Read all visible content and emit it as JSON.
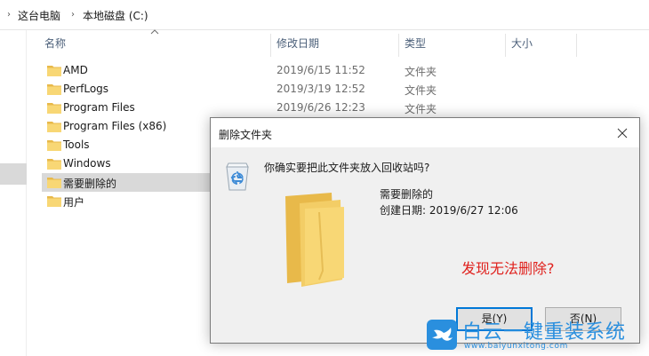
{
  "breadcrumb": {
    "items": [
      "这台电脑",
      "本地磁盘 (C:)"
    ]
  },
  "columns": {
    "name": "名称",
    "date": "修改日期",
    "type": "类型",
    "size": "大小"
  },
  "files": [
    {
      "name": "AMD",
      "date": "2019/6/15 11:52",
      "type": "文件夹"
    },
    {
      "name": "PerfLogs",
      "date": "2019/3/19 12:52",
      "type": "文件夹"
    },
    {
      "name": "Program Files",
      "date": "2019/6/26 12:23",
      "type": "文件夹"
    },
    {
      "name": "Program Files (x86)",
      "date": "",
      "type": ""
    },
    {
      "name": "Tools",
      "date": "",
      "type": ""
    },
    {
      "name": "Windows",
      "date": "",
      "type": ""
    },
    {
      "name": "需要删除的",
      "date": "",
      "type": ""
    },
    {
      "name": "用户",
      "date": "",
      "type": ""
    }
  ],
  "dialog": {
    "title": "删除文件夹",
    "question": "你确实要把此文件夹放入回收站吗?",
    "folder_name": "需要删除的",
    "created": "创建日期: 2019/6/27 12:06",
    "annotation": "发现无法删除?",
    "yes_label": "是(Y)",
    "no_label": "否(N)"
  },
  "watermark": {
    "brand": "白云一键重装系统",
    "url": "www.baiyunxitong.com"
  },
  "colors": {
    "folder": "#f8d775",
    "folder_dark": "#e8b94a",
    "accent": "#0078d7",
    "annotation": "#e0211d",
    "watermark": "#2a8fde"
  }
}
